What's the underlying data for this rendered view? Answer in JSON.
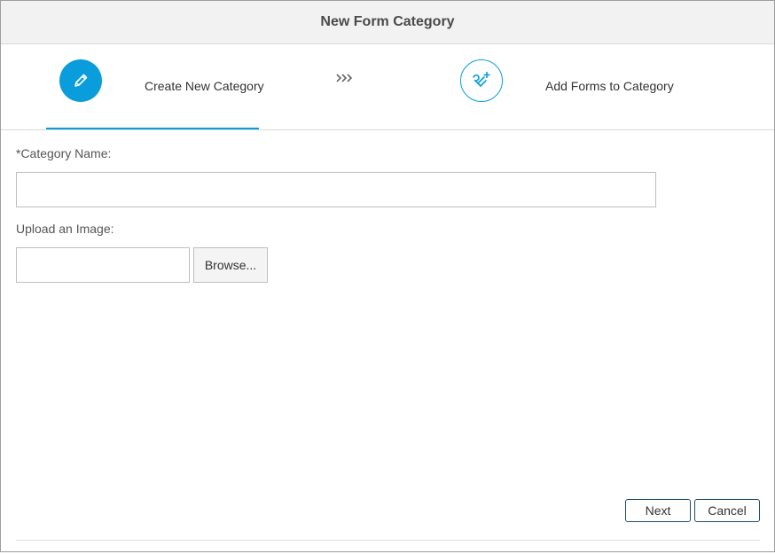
{
  "dialog": {
    "title": "New Form Category"
  },
  "wizard": {
    "steps": [
      {
        "label": "Create New Category",
        "icon": "pencil-icon",
        "active": true
      },
      {
        "label": "Add Forms to Category",
        "icon": "add-forms-icon",
        "active": false
      }
    ],
    "separator_icon": "triple-chevron-right-icon"
  },
  "form": {
    "category_name_label": "*Category Name:",
    "category_name_value": "",
    "upload_label": "Upload an Image:",
    "upload_value": "",
    "browse_label": "Browse..."
  },
  "footer": {
    "next_label": "Next",
    "cancel_label": "Cancel"
  },
  "colors": {
    "accent": "#0a9ddb",
    "button_border": "#1f4e6e",
    "titlebar_bg": "#f2f2f2"
  }
}
